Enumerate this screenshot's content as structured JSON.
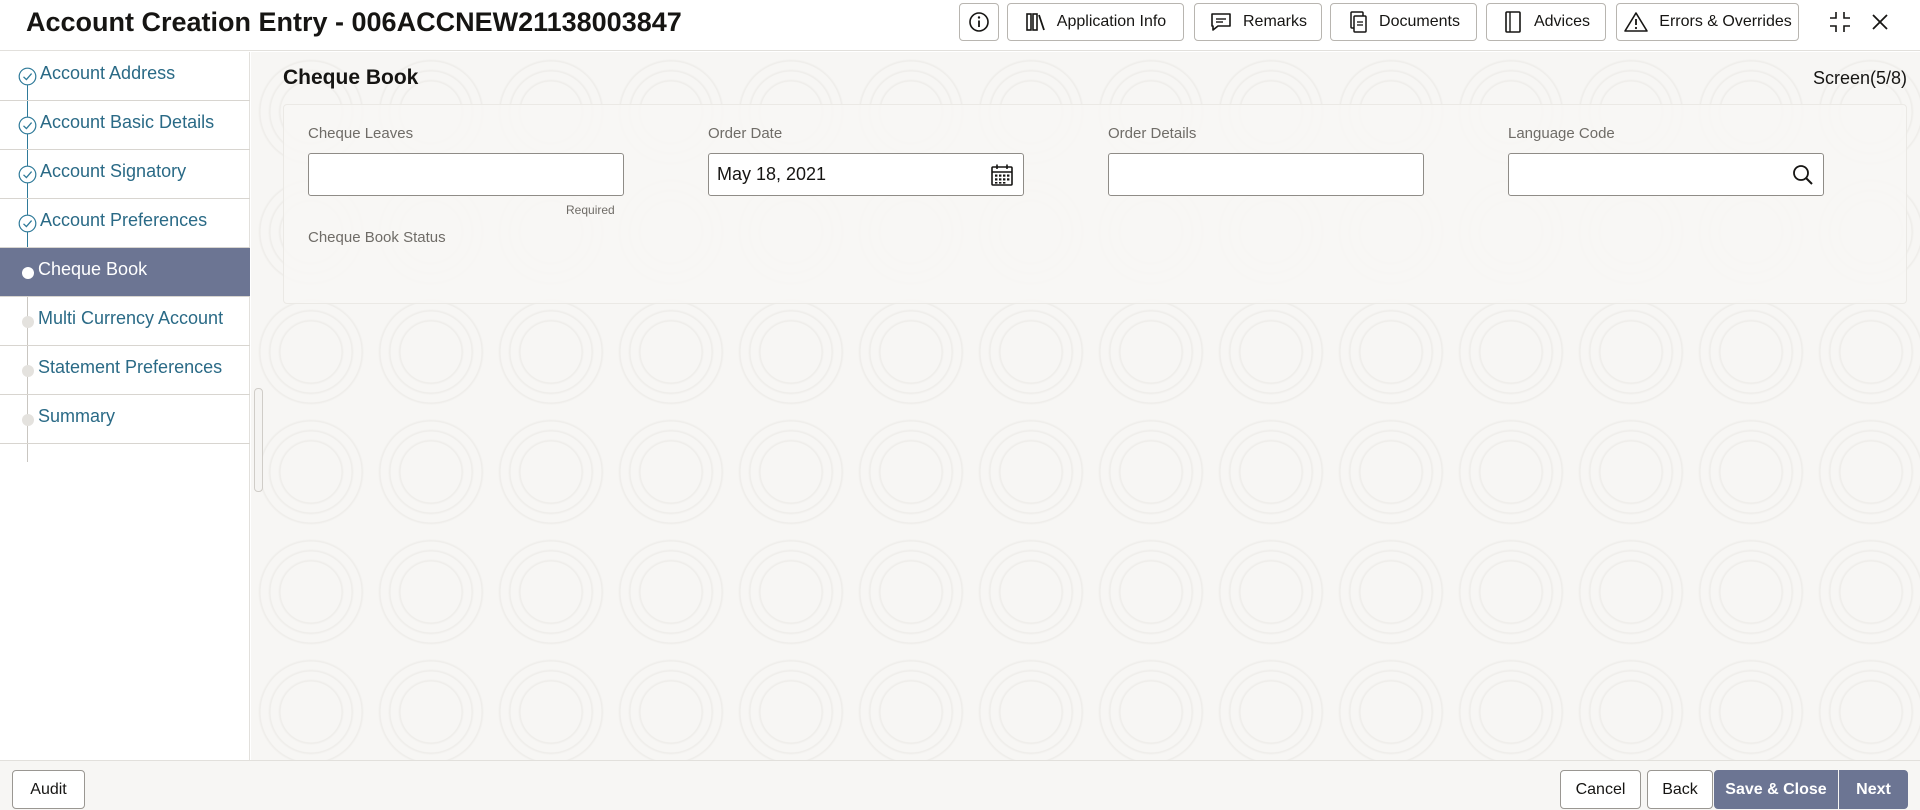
{
  "header": {
    "title": "Account Creation Entry - 006ACCNEW21138003847",
    "buttons": {
      "application_info": "Application Info",
      "remarks": "Remarks",
      "documents": "Documents",
      "advices": "Advices",
      "errors_overrides": "Errors & Overrides"
    },
    "icons": [
      "info-icon",
      "library-icon",
      "chat-icon",
      "documents-icon",
      "notebook-icon",
      "warning-icon",
      "collapse-icon",
      "close-icon"
    ]
  },
  "sidebar": {
    "items": [
      {
        "label": "Account Address",
        "state": "completed"
      },
      {
        "label": "Account Basic Details",
        "state": "completed"
      },
      {
        "label": "Account Signatory",
        "state": "completed"
      },
      {
        "label": "Account Preferences",
        "state": "completed"
      },
      {
        "label": "Cheque Book",
        "state": "active"
      },
      {
        "label": "Multi Currency Account",
        "state": "pending"
      },
      {
        "label": "Statement Preferences",
        "state": "pending"
      },
      {
        "label": "Summary",
        "state": "pending"
      }
    ]
  },
  "main": {
    "section_title": "Cheque Book",
    "screen_counter": "Screen(5/8)",
    "fields": {
      "cheque_leaves": {
        "label": "Cheque Leaves",
        "value": "",
        "hint": "Required"
      },
      "order_date": {
        "label": "Order Date",
        "value": "May 18, 2021"
      },
      "order_details": {
        "label": "Order Details",
        "value": ""
      },
      "language_code": {
        "label": "Language Code",
        "value": ""
      },
      "cheque_book_status": {
        "label": "Cheque Book Status"
      }
    }
  },
  "footer": {
    "audit": "Audit",
    "cancel": "Cancel",
    "back": "Back",
    "save_close": "Save & Close",
    "next": "Next"
  },
  "colors": {
    "accent": "#6c7593",
    "link": "#2a6a86",
    "completed_marker": "#2f7a99"
  }
}
